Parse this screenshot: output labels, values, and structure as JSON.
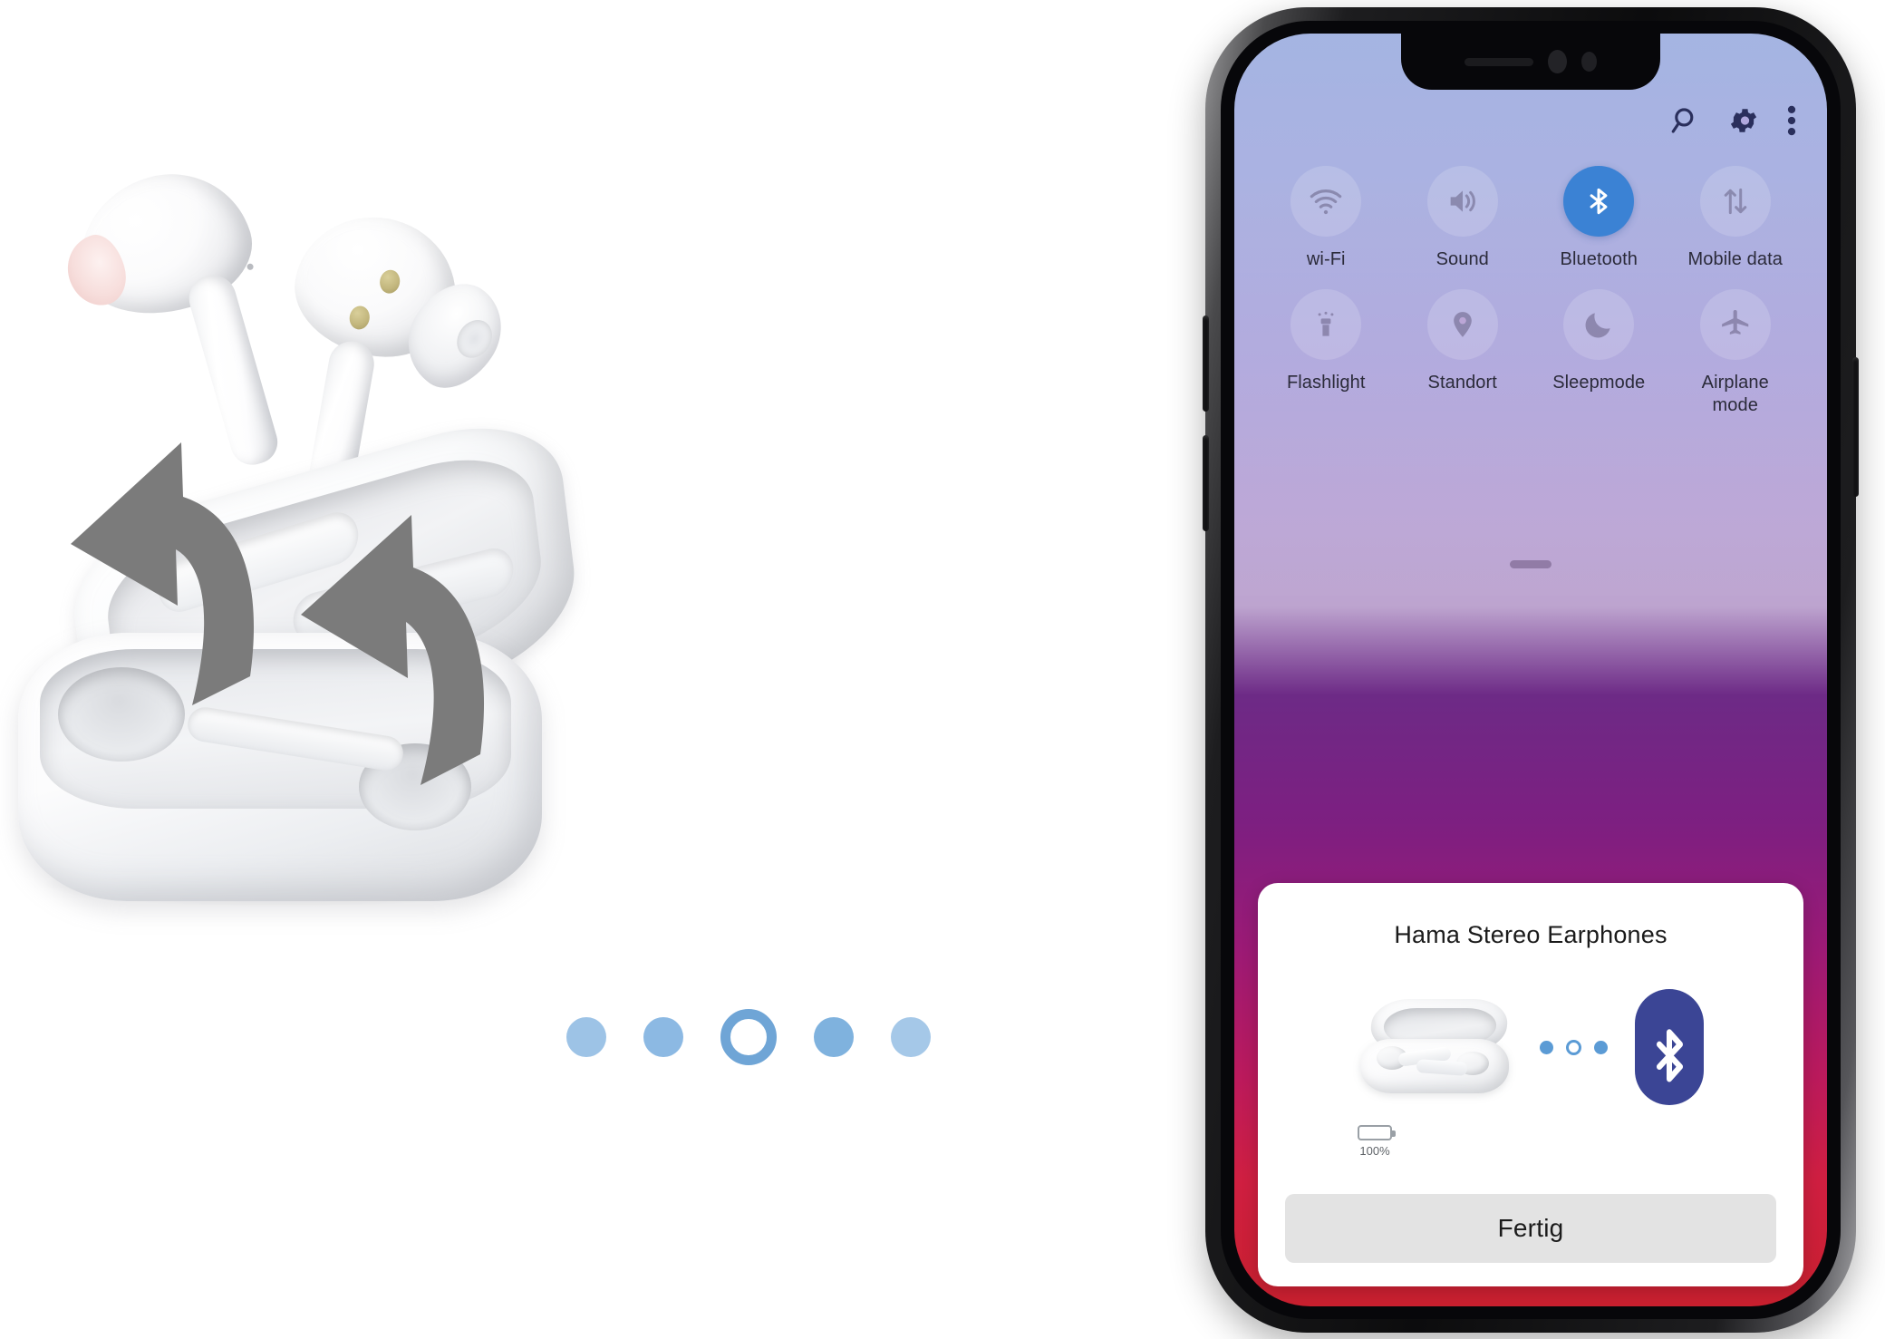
{
  "product": {
    "earbud_left_name": "earbud-left",
    "earbud_right_name": "earbud-right",
    "case_name": "charging-case",
    "arrow_hint": "remove-earbuds-arrow"
  },
  "progress_dots": [
    {
      "state": "filled"
    },
    {
      "state": "filled"
    },
    {
      "state": "current"
    },
    {
      "state": "filled"
    },
    {
      "state": "filled"
    }
  ],
  "phone": {
    "quick_settings": {
      "topbar": [
        {
          "icon": "search-icon",
          "label": "Search"
        },
        {
          "icon": "gear-icon",
          "label": "Settings"
        },
        {
          "icon": "overflow-menu-icon",
          "label": "More options"
        }
      ],
      "tiles": [
        {
          "label": "wi-Fi",
          "icon": "wifi-icon",
          "active": false
        },
        {
          "label": "Sound",
          "icon": "speaker-icon",
          "active": false
        },
        {
          "label": "Bluetooth",
          "icon": "bluetooth-icon",
          "active": true
        },
        {
          "label": "Mobile\ndata",
          "icon": "mobile-data-icon",
          "active": false
        },
        {
          "label": "Flashlight",
          "icon": "flashlight-icon",
          "active": false
        },
        {
          "label": "Standort",
          "icon": "location-pin-icon",
          "active": false
        },
        {
          "label": "Sleepmode",
          "icon": "moon-icon",
          "active": false
        },
        {
          "label": "Airplane\nmode",
          "icon": "airplane-icon",
          "active": false
        }
      ],
      "handle_name": "panel-drag-handle"
    },
    "pairing_card": {
      "title": "Hama Stereo Earphones",
      "device_image": "earphone-case-image",
      "bluetooth_logo": "bluetooth-logo",
      "link_dots": [
        "filled",
        "hollow",
        "filled"
      ],
      "battery": {
        "percent_label": "100%",
        "fill_percent": 100,
        "fill_color": "#4caf7d"
      },
      "done_button": "Fertig"
    }
  },
  "colors": {
    "accent_blue": "#3b82d4",
    "bluetooth_navy": "#3b4595",
    "dot_blue": "#7fb2de",
    "battery_green": "#4caf7d",
    "button_gray": "#e3e3e3"
  }
}
